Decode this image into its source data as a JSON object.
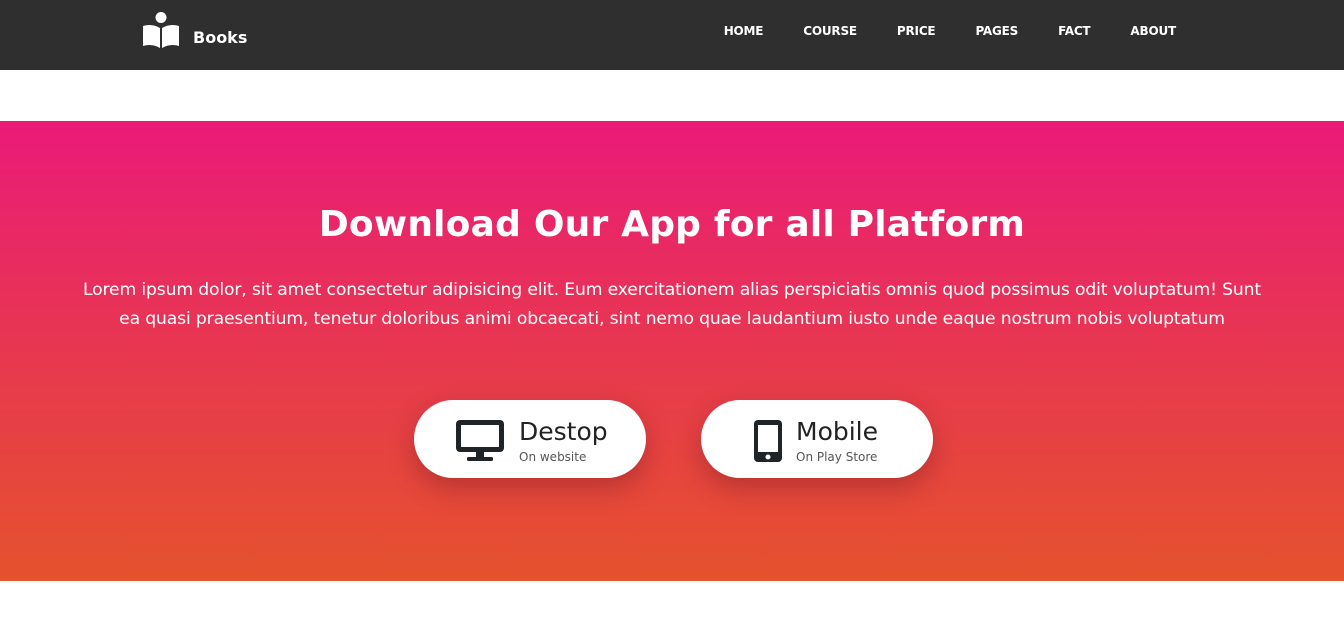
{
  "header": {
    "brand": {
      "name": "Books",
      "icon": "book-reader-icon"
    },
    "nav": [
      {
        "label": "HOME"
      },
      {
        "label": "COURSE"
      },
      {
        "label": "PRICE"
      },
      {
        "label": "PAGES"
      },
      {
        "label": "FACT"
      },
      {
        "label": "ABOUT"
      }
    ]
  },
  "hero": {
    "title": "Download Our App for all Platform",
    "description": "Lorem ipsum dolor, sit amet consectetur adipisicing elit. Eum exercitationem alias perspiciatis omnis quod possimus odit voluptatum! Sunt ea quasi praesentium, tenetur doloribus animi obcaecati, sint nemo quae laudantium iusto unde eaque nostrum nobis voluptatum",
    "gradient": [
      "#ea1a78",
      "#e5522d"
    ],
    "buttons": [
      {
        "title": "Destop",
        "subtitle": "On website",
        "icon": "desktop-monitor-icon"
      },
      {
        "title": "Mobile",
        "subtitle": "On Play Store",
        "icon": "mobile-phone-icon"
      }
    ]
  },
  "colors": {
    "navbar": "#2f2f2f",
    "text_light": "#ffffff",
    "text_dark": "#222222"
  }
}
